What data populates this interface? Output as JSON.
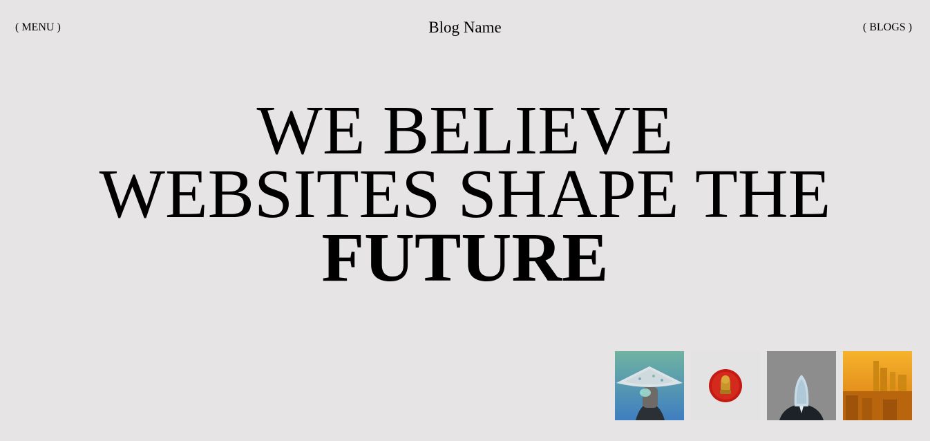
{
  "header": {
    "menu_label": "( MENU )",
    "brand": "Blog Name",
    "blogs_label": "( BLOGS )"
  },
  "hero": {
    "line1": "WE BELIEVE",
    "line2": "WEBSITES SHAPE THE",
    "line3": "FUTURE"
  },
  "thumbnails": [
    {
      "icon": "conical-hat-figure-image"
    },
    {
      "icon": "red-disc-gold-cat-image"
    },
    {
      "icon": "veiled-suit-figure-image"
    },
    {
      "icon": "orange-city-skyline-image"
    }
  ],
  "colors": {
    "background": "#e6e4e4",
    "text": "#000000"
  }
}
